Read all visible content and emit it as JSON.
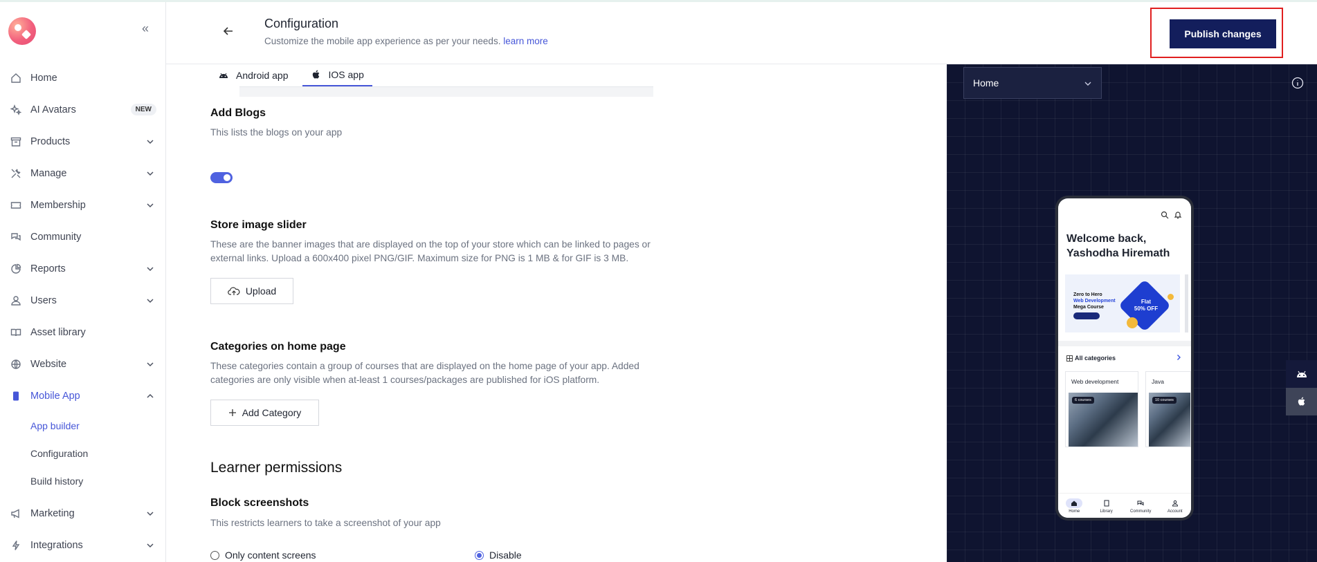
{
  "sidebar": {
    "items": [
      {
        "label": "Home",
        "icon": "home-icon",
        "has_chevron": false
      },
      {
        "label": "AI Avatars",
        "icon": "sparkle-icon",
        "badge": "NEW"
      },
      {
        "label": "Products",
        "icon": "archive-icon"
      },
      {
        "label": "Manage",
        "icon": "tools-icon"
      },
      {
        "label": "Membership",
        "icon": "ticket-icon"
      },
      {
        "label": "Community",
        "icon": "chat-icon"
      },
      {
        "label": "Reports",
        "icon": "pie-chart-icon"
      },
      {
        "label": "Users",
        "icon": "user-icon"
      },
      {
        "label": "Asset library",
        "icon": "book-icon"
      },
      {
        "label": "Website",
        "icon": "globe-icon"
      },
      {
        "label": "Mobile App",
        "icon": "phone-icon"
      },
      {
        "label": "Marketing",
        "icon": "megaphone-icon"
      },
      {
        "label": "Integrations",
        "icon": "plug-icon"
      }
    ],
    "mobile_sub": [
      "App builder",
      "Configuration",
      "Build history"
    ]
  },
  "header": {
    "title": "Configuration",
    "subtitle": "Customize the mobile app experience as per your needs.",
    "learn_more": "learn more",
    "publish": "Publish changes"
  },
  "tabs": [
    {
      "label": "Android app",
      "icon": "android-icon"
    },
    {
      "label": "IOS app",
      "icon": "apple-icon"
    }
  ],
  "sections": {
    "blogs": {
      "title": "Add Blogs",
      "desc": "This lists the blogs on your app",
      "enabled": true
    },
    "slider": {
      "title": "Store image slider",
      "desc": "These are the banner images that are displayed on the top of your store which can be linked to pages or external links. Upload a 600x400 pixel PNG/GIF. Maximum size for PNG is 1 MB & for GIF is 3 MB.",
      "button": "Upload"
    },
    "categories": {
      "title": "Categories on home page",
      "desc": "These categories contain a group of courses that are displayed on the home page of your app. Added categories are only visible when at-least 1 courses/packages are published for iOS platform.",
      "button": "Add Category"
    },
    "permissions": {
      "title": "Learner permissions"
    },
    "screenshots": {
      "title": "Block screenshots",
      "desc": "This restricts learners to take a screenshot of your app",
      "options": [
        "Only content screens",
        "Disable"
      ],
      "selected": "Disable"
    }
  },
  "preview": {
    "page": "Home",
    "welcome": "Welcome back, Yashodha Hiremath",
    "banner": {
      "line1": "Zero to Hero",
      "line2": "Web Development",
      "line3": "Mega Course",
      "offer1": "Flat",
      "offer2": "50% OFF"
    },
    "categories_label": "All categories",
    "cards": [
      {
        "title": "Web development",
        "count": "6 courses"
      },
      {
        "title": "Java",
        "count": "10 courses"
      }
    ],
    "tabbar": [
      "Home",
      "Library",
      "Community",
      "Account"
    ]
  }
}
